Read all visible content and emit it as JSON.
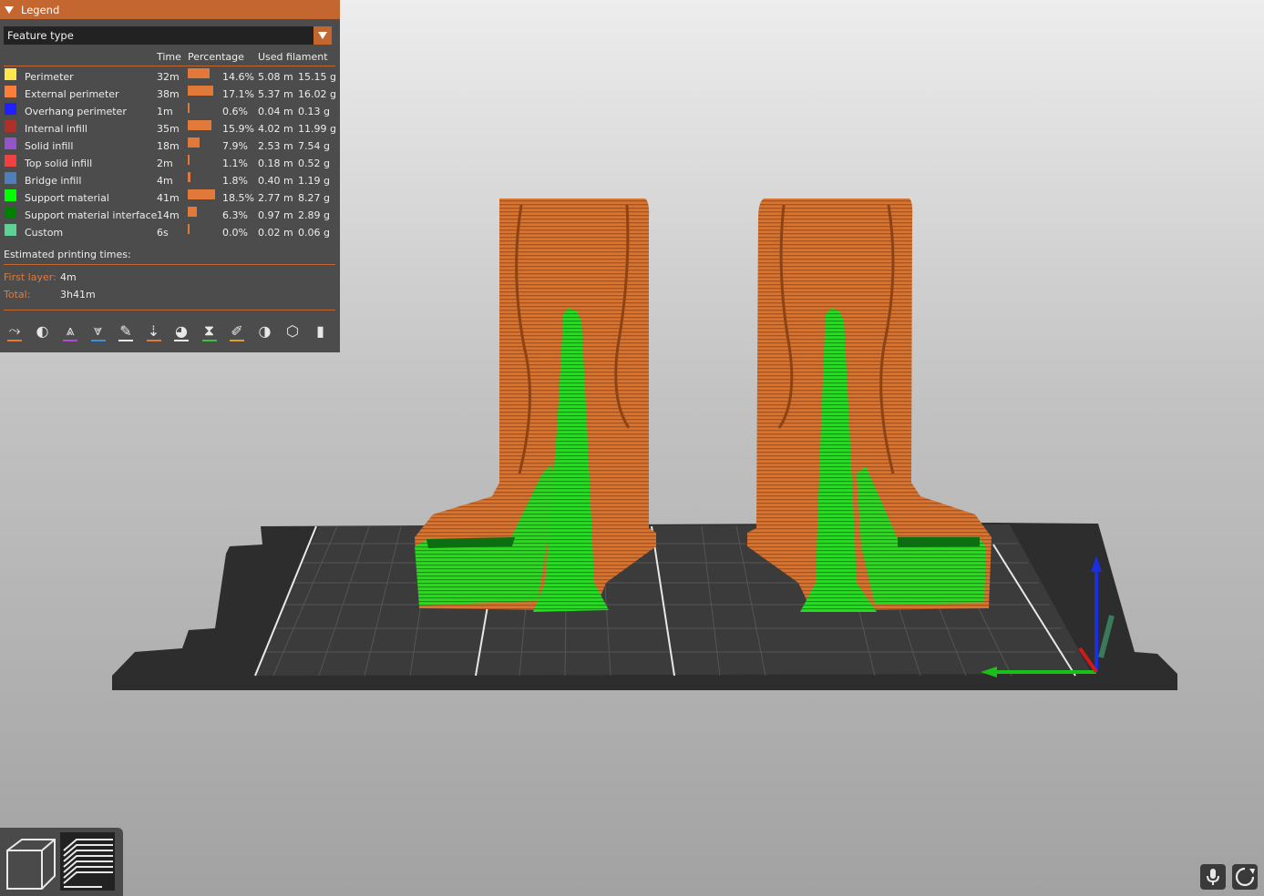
{
  "legend": {
    "title": "Legend",
    "view_type": "Feature type",
    "columns": {
      "time": "Time",
      "percentage": "Percentage",
      "used_filament": "Used filament"
    },
    "rows": [
      {
        "name": "Perimeter",
        "color": "#FFE648",
        "time": "32m",
        "fraction": 0.146,
        "percent": "14.6%",
        "length": "5.08 m",
        "weight": "15.15 g"
      },
      {
        "name": "External perimeter",
        "color": "#FF7D38",
        "time": "38m",
        "fraction": 0.171,
        "percent": "17.1%",
        "length": "5.37 m",
        "weight": "16.02 g"
      },
      {
        "name": "Overhang perimeter",
        "color": "#1F1FFF",
        "time": "1m",
        "fraction": 0.006,
        "percent": "0.6%",
        "length": "0.04 m",
        "weight": "0.13 g"
      },
      {
        "name": "Internal infill",
        "color": "#B03029",
        "time": "35m",
        "fraction": 0.159,
        "percent": "15.9%",
        "length": "4.02 m",
        "weight": "11.99 g"
      },
      {
        "name": "Solid infill",
        "color": "#9654CC",
        "time": "18m",
        "fraction": 0.079,
        "percent": "7.9%",
        "length": "2.53 m",
        "weight": "7.54 g"
      },
      {
        "name": "Top solid infill",
        "color": "#F04040",
        "time": "2m",
        "fraction": 0.011,
        "percent": "1.1%",
        "length": "0.18 m",
        "weight": "0.52 g"
      },
      {
        "name": "Bridge infill",
        "color": "#4D80BA",
        "time": "4m",
        "fraction": 0.018,
        "percent": "1.8%",
        "length": "0.40 m",
        "weight": "1.19 g"
      },
      {
        "name": "Support material",
        "color": "#00FF00",
        "time": "41m",
        "fraction": 0.185,
        "percent": "18.5%",
        "length": "2.77 m",
        "weight": "8.27 g"
      },
      {
        "name": "Support material interface",
        "color": "#008000",
        "time": "14m",
        "fraction": 0.063,
        "percent": "6.3%",
        "length": "0.97 m",
        "weight": "2.89 g"
      },
      {
        "name": "Custom",
        "color": "#5ED194",
        "time": "6s",
        "fraction": 0.0,
        "percent": "0.0%",
        "length": "0.02 m",
        "weight": "0.06 g"
      }
    ],
    "estimated_label": "Estimated printing times:",
    "first_layer_label": "First layer:",
    "first_layer_value": "4m",
    "total_label": "Total:",
    "total_value": "3h41m",
    "toolbar_icons": [
      "travel-icon",
      "wipe-icon",
      "retractions-icon",
      "deretractions-icon",
      "seams-icon",
      "tool-changes-icon",
      "color-changes-icon",
      "pause-prints-icon",
      "custom-gcodes-icon",
      "center-of-gravity-icon",
      "shells-icon",
      "tool-marker-icon"
    ]
  },
  "colors": {
    "accent": "#C3662F",
    "panel": "#4C4C4C",
    "support": "#00FF00",
    "perimeter": "#FF7D38"
  }
}
